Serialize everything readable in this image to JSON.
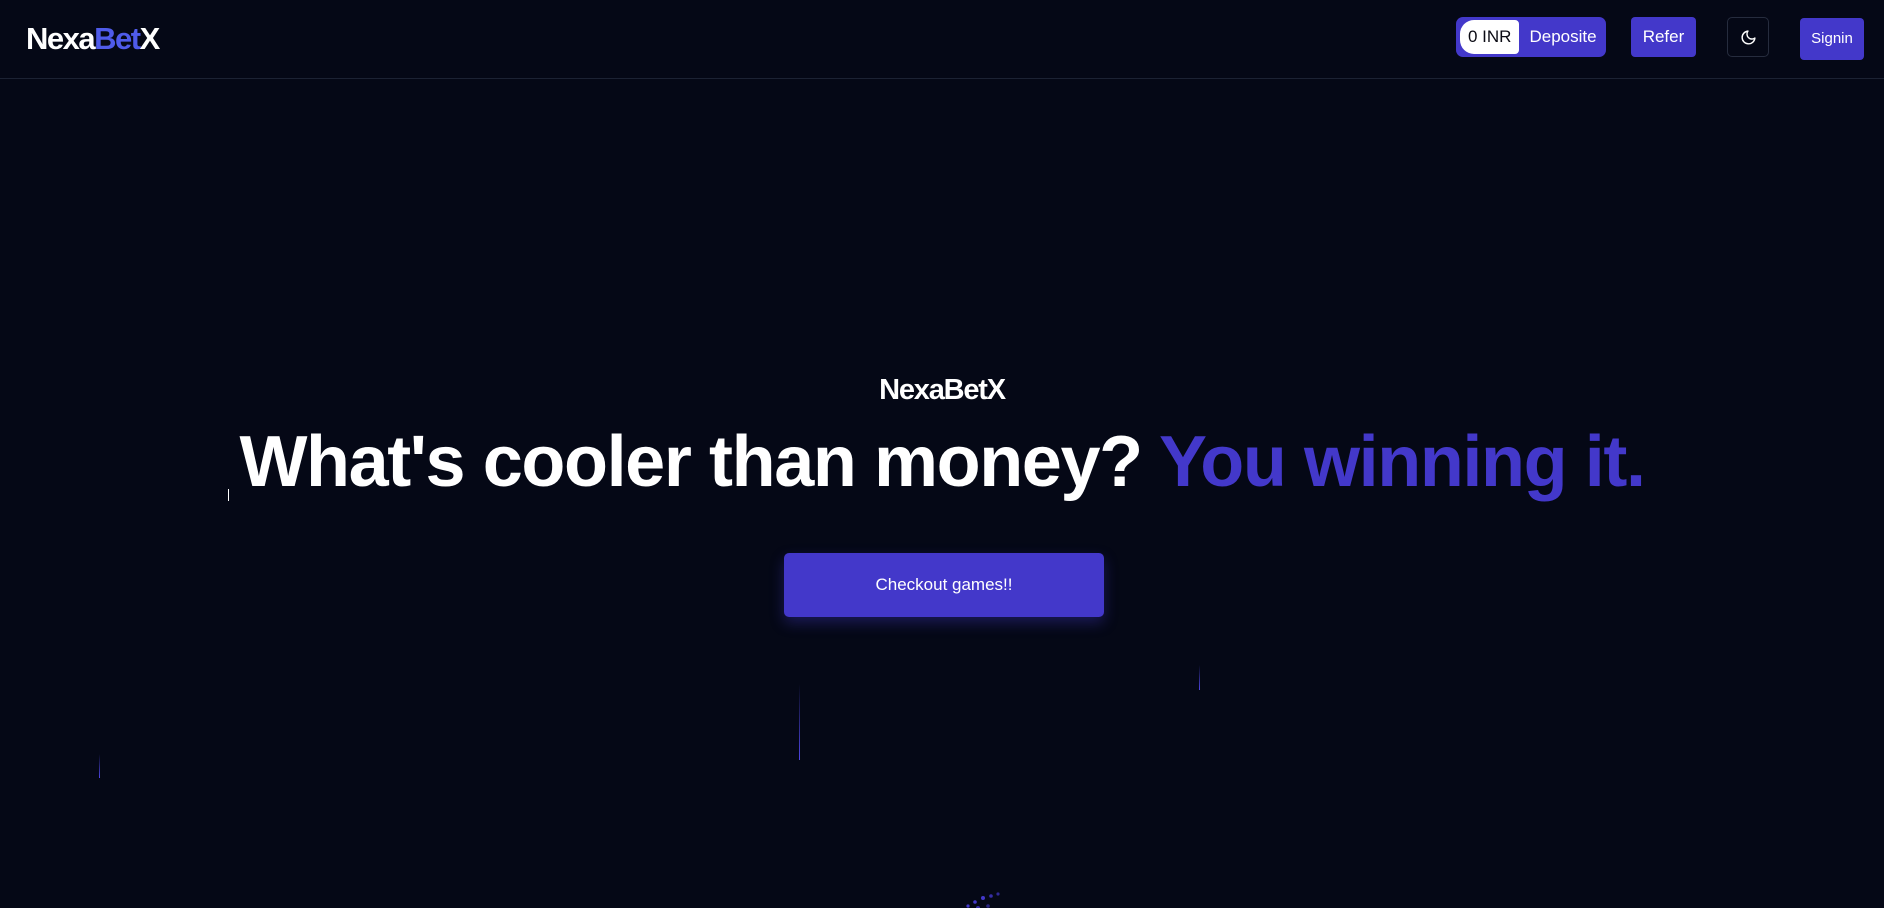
{
  "header": {
    "logo": {
      "part1": "Nexa",
      "part2": "Bet",
      "part3": "X"
    },
    "balance": "0 INR",
    "deposit_label": "Deposite",
    "refer_label": "Refer",
    "theme_icon": "moon-icon",
    "signin_label": "Signin"
  },
  "hero": {
    "brand": "NexaBetX",
    "headline_part1": "What's cooler than money? ",
    "headline_part2": "You winning it.",
    "cta_label": "Checkout games!!"
  },
  "colors": {
    "background": "#050816",
    "accent": "#4338ca",
    "logo_accent": "#4f5bea",
    "text": "#ffffff"
  }
}
